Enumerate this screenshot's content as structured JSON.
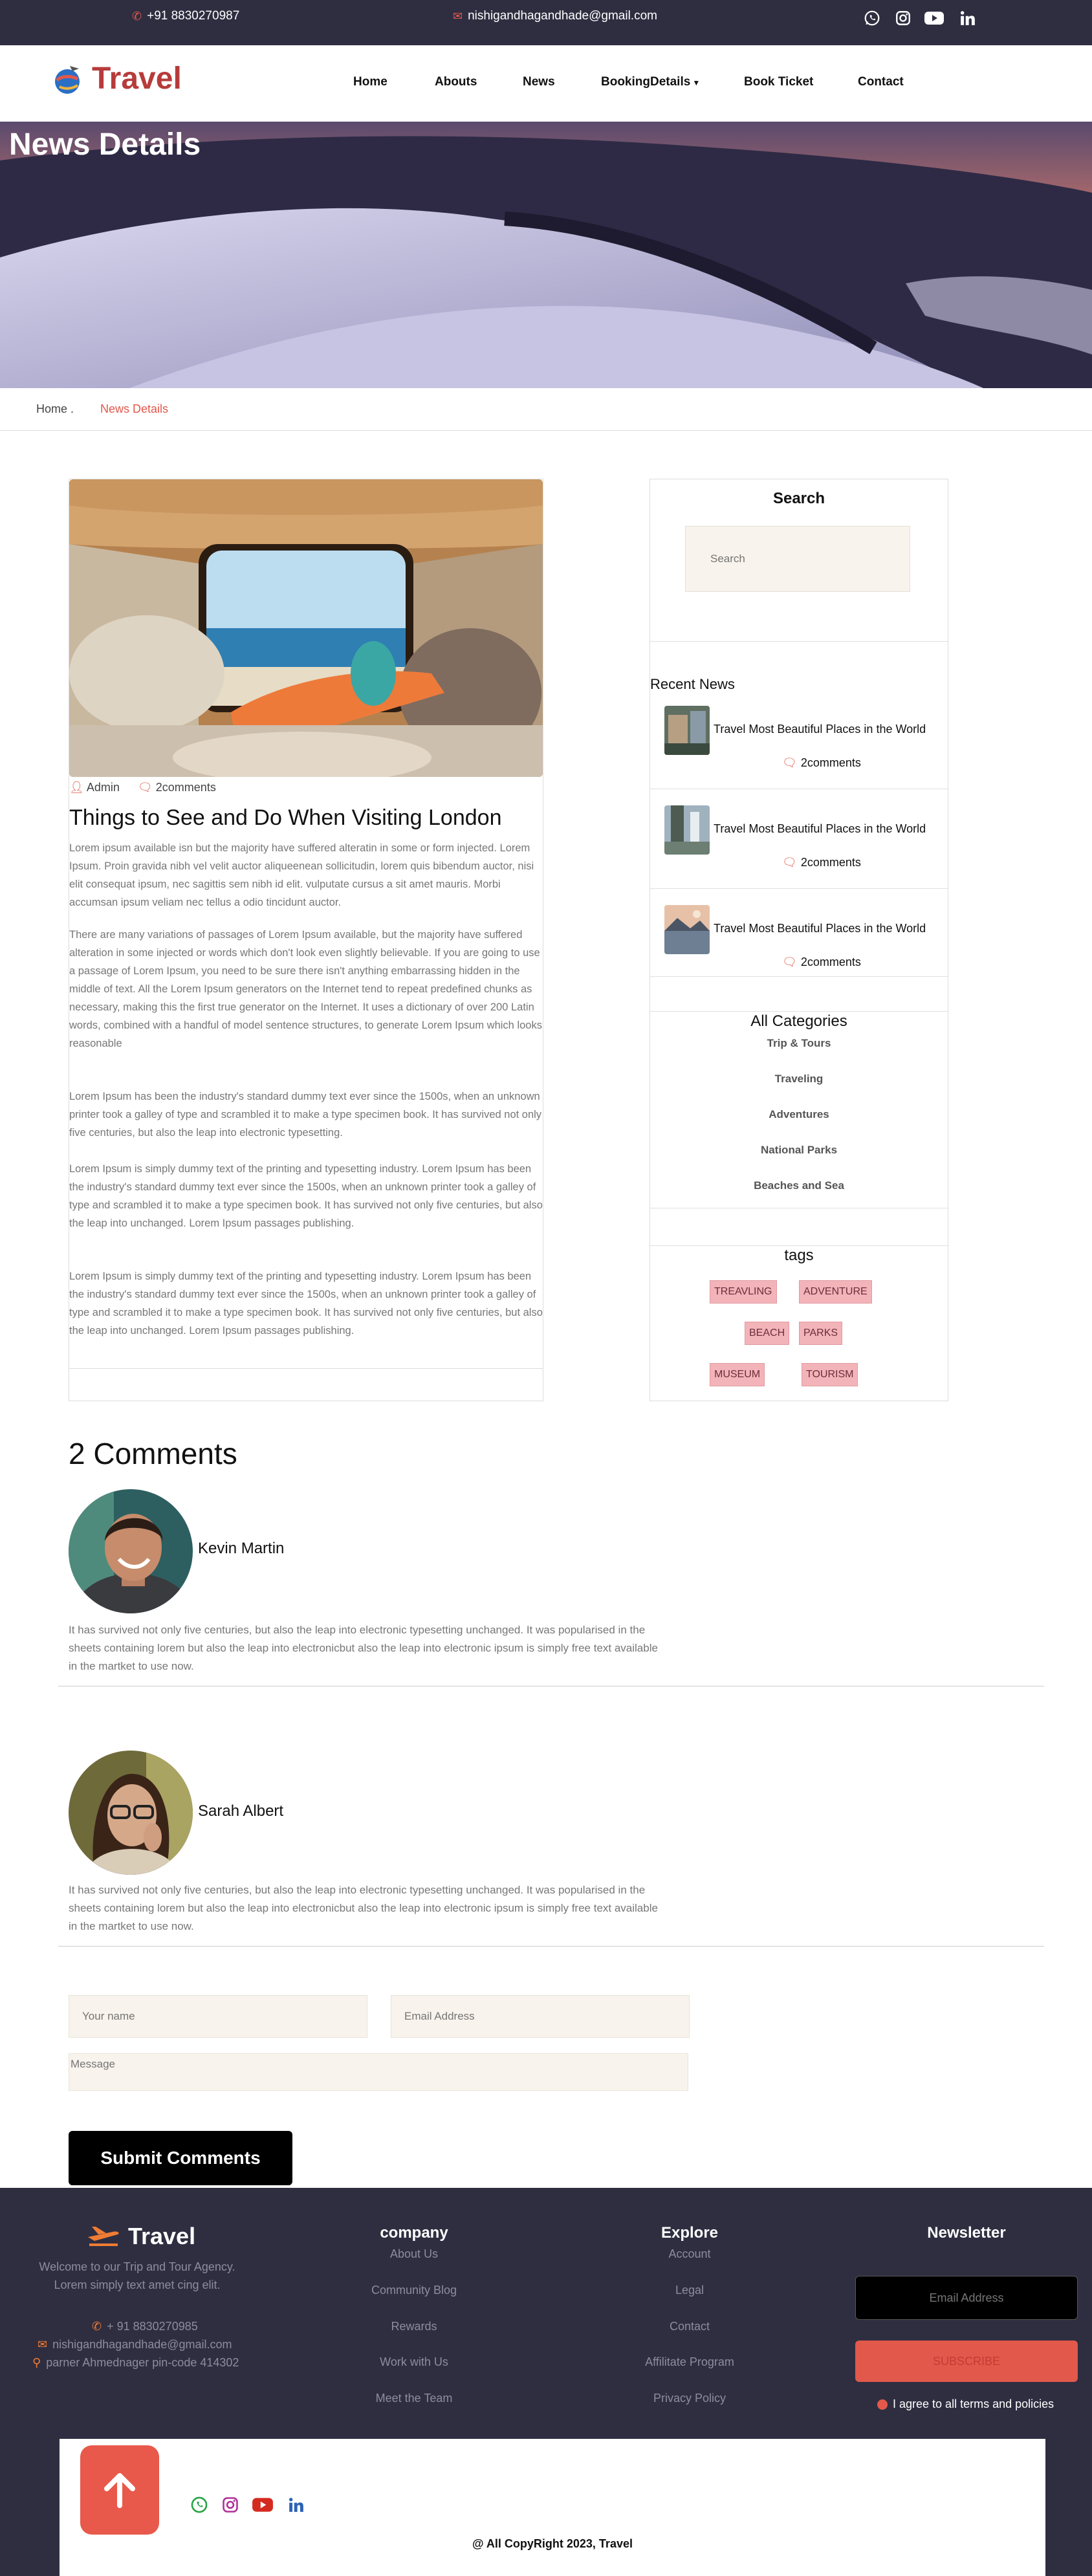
{
  "topbar": {
    "phone": "+91 8830270987",
    "email": "nishigandhagandhade@gmail.com",
    "social_icons": [
      "whatsapp-icon",
      "instagram-icon",
      "youtube-icon",
      "linkedin-icon"
    ]
  },
  "nav": {
    "logo_text": "Travel",
    "links": [
      "Home",
      "Abouts",
      "News",
      "BookingDetails",
      "Book Ticket",
      "Contact"
    ]
  },
  "hero": {
    "title": "News Details"
  },
  "breadcrumb": {
    "home": "Home .",
    "current": "News Details"
  },
  "article": {
    "author": "Admin",
    "comments_count": "2comments",
    "title": "Things to See and Do When Visiting London",
    "paragraphs": [
      "Lorem ipsum available isn but the majority have suffered alteratin in some or form injected. Lorem Ipsum. Proin gravida nibh vel velit auctor aliqueenean sollicitudin, lorem quis bibendum auctor, nisi elit consequat ipsum, nec sagittis sem nibh id elit. vulputate cursus a sit amet mauris. Morbi accumsan ipsum veliam nec tellus a odio tincidunt auctor.",
      "There are many variations of passages of Lorem Ipsum available, but the majority have suffered alteration in some injected or words which don't look even slightly believable. If you are going to use a passage of Lorem Ipsum, you need to be sure there isn't anything embarrassing hidden in the middle of text. All the Lorem Ipsum generators on the Internet tend to repeat predefined chunks as necessary, making this the first true generator on the Internet. It uses a dictionary of over 200 Latin words, combined with a handful of model sentence structures, to generate Lorem Ipsum which looks reasonable",
      "Lorem Ipsum has been the industry's standard dummy text ever since the 1500s, when an unknown printer took a galley of type and scrambled it to make a type specimen book. It has survived not only five centuries, but also the leap into electronic typesetting.",
      "Lorem Ipsum is simply dummy text of the printing and typesetting industry. Lorem Ipsum has been the industry's standard dummy text ever since the 1500s, when an unknown printer took a galley of type and scrambled it to make a type specimen book. It has survived not only five centuries, but also the leap into unchanged. Lorem Ipsum passages publishing.",
      "Lorem Ipsum is simply dummy text of the printing and typesetting industry. Lorem Ipsum has been the industry's standard dummy text ever since the 1500s, when an unknown printer took a galley of type and scrambled it to make a type specimen book. It has survived not only five centuries, but also the leap into unchanged. Lorem Ipsum passages publishing."
    ]
  },
  "sidebar": {
    "search_title": "Search",
    "search_placeholder": "Search",
    "recent_title": "Recent News",
    "recent": [
      {
        "title": "Travel Most Beautiful Places in the World",
        "comments": "2comments"
      },
      {
        "title": "Travel Most Beautiful Places in the World",
        "comments": "2comments"
      },
      {
        "title": "Travel Most Beautiful Places in the World",
        "comments": "2comments"
      }
    ],
    "categories_title": "All Categories",
    "categories": [
      "Trip & Tours",
      "Traveling",
      "Adventures",
      "National Parks",
      "Beaches and Sea"
    ],
    "tags_title": "tags",
    "tags": [
      "TREAVLING",
      "ADVENTURE",
      "BEACH",
      "PARKS",
      "MUSEUM",
      "TOURISM"
    ]
  },
  "comments": {
    "title": "2 Comments",
    "items": [
      {
        "name": "Kevin Martin",
        "text": "It has survived not only five centuries, but also the leap into electronic typesetting unchanged. It was popularised in the sheets containing lorem but also the leap into electronicbut also the leap into electronic ipsum is simply free text available in the martket to use now."
      },
      {
        "name": "Sarah Albert",
        "text": "It has survived not only five centuries, but also the leap into electronic typesetting unchanged. It was popularised in the sheets containing lorem but also the leap into electronicbut also the leap into electronic ipsum is simply free text available in the martket to use now."
      }
    ]
  },
  "form": {
    "name_placeholder": "Your name",
    "email_placeholder": "Email Address",
    "message_placeholder": "Message",
    "submit_label": "Submit Comments"
  },
  "footer": {
    "logo_text": "Travel",
    "about": [
      "Welcome to our Trip and Tour Agency.",
      "Lorem simply text amet cing elit."
    ],
    "phone": "+ 91 8830270985",
    "email": "nishigandhagandhade@gmail.com",
    "address": "parner Ahmednager pin-code 414302",
    "company_title": "company",
    "company_links": [
      "About Us",
      "Community Blog",
      "Rewards",
      "Work with Us",
      "Meet the Team"
    ],
    "explore_title": "Explore",
    "explore_links": [
      "Account",
      "Legal",
      "Contact",
      "Affilitate Program",
      "Privacy Policy"
    ],
    "newsletter_title": "Newsletter",
    "newsletter_placeholder": "Email Address",
    "subscribe_label": "SUBSCRIBE",
    "terms_label": "I agree to all terms and policies",
    "copyright": "@ All CopyRight 2023, Travel",
    "social_icons": [
      "whatsapp-icon",
      "instagram-icon",
      "youtube-icon",
      "linkedin-icon"
    ]
  },
  "colors": {
    "accent": "#e2584b",
    "dark": "#2f2e41",
    "brand_red": "#b73b3b",
    "field_bg": "#f8f3ec"
  }
}
